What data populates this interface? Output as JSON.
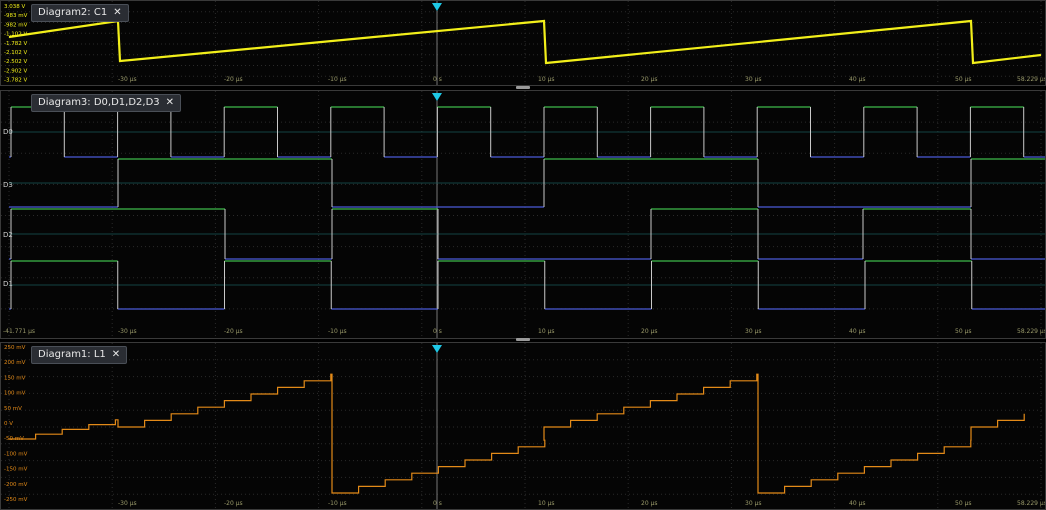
{
  "panels": {
    "diagram2": {
      "title": "Diagram2: C1",
      "close": "✕",
      "y_labels": [
        "3.038 V",
        "-983 mV",
        "-982 mV",
        "-1.102 V",
        "-1.782 V",
        "-2.102 V",
        "-2.502 V",
        "-2.902 V",
        "-3.782 V"
      ]
    },
    "diagram3": {
      "title": "Diagram3: D0,D1,D2,D3",
      "close": "✕",
      "channels": [
        "D0",
        "D3",
        "D2",
        "D1"
      ],
      "left_time": "-41.771 µs"
    },
    "diagram1": {
      "title": "Diagram1: L1",
      "close": "✕",
      "y_labels": [
        "250 mV",
        "200 mV",
        "150 mV",
        "100 mV",
        "50 mV",
        "0 V",
        "-50 mV",
        "-100 mV",
        "-150 mV",
        "-200 mV",
        "-250 mV"
      ]
    }
  },
  "time_axis": {
    "ticks": [
      "-30 µs",
      "-20 µs",
      "-10 µs",
      "0 s",
      "10 µs",
      "20 µs",
      "30 µs",
      "40 µs",
      "50 µs"
    ],
    "right": "58.229 µs"
  },
  "colors": {
    "c1": "#f2ef1a",
    "low": "#4a5bd8",
    "high": "#3dbb4a",
    "edge": "#c9c9c9",
    "l1": "#e38a18",
    "grid": "#2a2a2a",
    "trigger": "#1ec8e6"
  },
  "icons": {
    "trigger": "trigger-marker-icon",
    "handle": "resize-handle-icon"
  }
}
